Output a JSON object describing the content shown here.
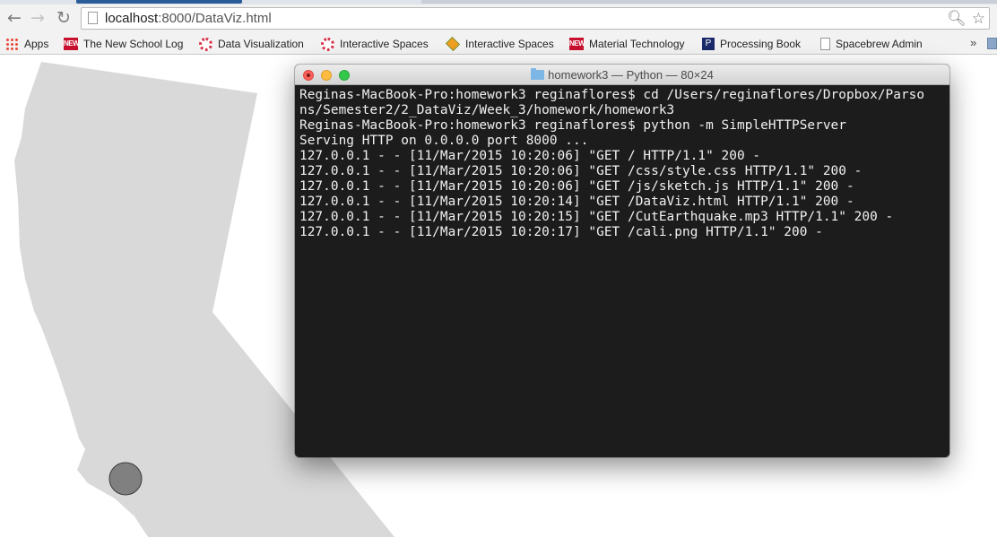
{
  "browser": {
    "url_host": "localhost",
    "url_path": ":8000/DataViz.html",
    "bookmarks": [
      {
        "label": "Apps",
        "icon": "apps-grid-icon"
      },
      {
        "label": "The New School Log",
        "icon": "newschool-icon"
      },
      {
        "label": "Data Visualization",
        "icon": "ring-icon"
      },
      {
        "label": "Interactive Spaces",
        "icon": "ring-icon"
      },
      {
        "label": "Interactive Spaces",
        "icon": "diamond-icon"
      },
      {
        "label": "Material Technology",
        "icon": "newschool-icon"
      },
      {
        "label": "Processing Book",
        "icon": "pbook-icon"
      },
      {
        "label": "Spacebrew Admin",
        "icon": "document-icon"
      }
    ],
    "bookmarks_overflow": "»"
  },
  "terminal": {
    "title": "homework3 — Python — 80×24",
    "lines": [
      "Reginas-MacBook-Pro:homework3 reginaflores$ cd /Users/reginaflores/Dropbox/Parso",
      "ns/Semester2/2_DataViz/Week_3/homework/homework3",
      "Reginas-MacBook-Pro:homework3 reginaflores$ python -m SimpleHTTPServer",
      "Serving HTTP on 0.0.0.0 port 8000 ...",
      "127.0.0.1 - - [11/Mar/2015 10:20:06] \"GET / HTTP/1.1\" 200 -",
      "127.0.0.1 - - [11/Mar/2015 10:20:06] \"GET /css/style.css HTTP/1.1\" 200 -",
      "127.0.0.1 - - [11/Mar/2015 10:20:06] \"GET /js/sketch.js HTTP/1.1\" 200 -",
      "127.0.0.1 - - [11/Mar/2015 10:20:14] \"GET /DataViz.html HTTP/1.1\" 200 -",
      "127.0.0.1 - - [11/Mar/2015 10:20:15] \"GET /CutEarthquake.mp3 HTTP/1.1\" 200 -",
      "127.0.0.1 - - [11/Mar/2015 10:20:17] \"GET /cali.png HTTP/1.1\" 200 -"
    ]
  },
  "colors": {
    "map_fill": "#d9d9d9",
    "marker_fill": "#808080",
    "terminal_bg": "#1c1c1c",
    "terminal_text": "#f2f2f2"
  }
}
